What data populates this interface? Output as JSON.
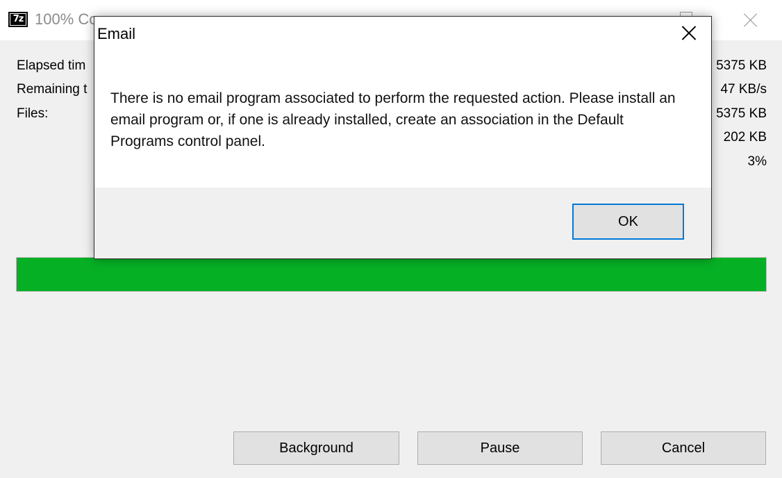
{
  "progress_window": {
    "icon_text": "7z",
    "title": "100% Co",
    "labels": {
      "elapsed": "Elapsed tim",
      "remaining": "Remaining t",
      "files": "Files:"
    },
    "values": {
      "total_size": "5375 KB",
      "speed": "47 KB/s",
      "processed": "5375 KB",
      "packed_size": "202 KB",
      "ratio": "3%"
    },
    "progress": {
      "fraction": 1.0,
      "color": "#06b025"
    },
    "buttons": {
      "background": "Background",
      "pause": "Pause",
      "cancel": "Cancel"
    }
  },
  "dialog": {
    "title": "Email",
    "message": "There is no email program associated to perform the requested action. Please install an email program or, if one is already installed, create an association in the Default Programs control panel.",
    "ok_label": "OK",
    "accent_color": "#0078d7"
  },
  "icons": {
    "app": "7zip-icon",
    "window_close": "close-icon",
    "window_maximize": "maximize-icon",
    "dialog_close": "close-icon"
  }
}
